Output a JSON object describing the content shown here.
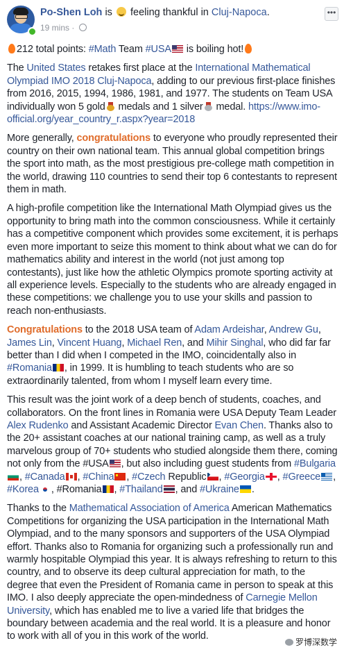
{
  "post": {
    "author": "Po-Shen Loh",
    "feeling_prefix": "is",
    "feeling_text": "feeling thankful in",
    "location": "Cluj-Napoca",
    "location_end": ".",
    "time": "19 mins",
    "time_sep": "·",
    "menu_label": "•••",
    "paragraphs": [
      [
        {
          "t": "",
          "icon": "fire"
        },
        {
          "t": "212 total points: "
        },
        {
          "t": "#Math",
          "l": 1
        },
        {
          "t": " Team "
        },
        {
          "t": "#USA",
          "l": 1
        },
        {
          "t": "",
          "icon": "flag-usa"
        },
        {
          "t": " is boiling hot!"
        },
        {
          "t": "",
          "icon": "fire"
        }
      ],
      [
        {
          "t": "The "
        },
        {
          "t": "United States",
          "l": 1
        },
        {
          "t": " retakes first place at the "
        },
        {
          "t": "International Mathematical Olympiad IMO 2018 Cluj-Napoca",
          "l": 1
        },
        {
          "t": ", adding to our previous first-place finishes from 2016, 2015, 1994, 1986, 1981, and 1977. The students on Team USA individually won 5 gold"
        },
        {
          "t": "",
          "icon": "medal-gold"
        },
        {
          "t": " medals and 1 silver"
        },
        {
          "t": "",
          "icon": "medal-silver"
        },
        {
          "t": " medal. "
        },
        {
          "t": "https://www.imo-official.org/year_country_r.aspx?year=2018",
          "l": 1
        }
      ],
      [
        {
          "t": "More generally, "
        },
        {
          "t": "congratulations",
          "h": 1
        },
        {
          "t": " to everyone who proudly represented their country on their own national team. This annual global competition brings the sport into math, as the most prestigious pre-college math competition in the world, drawing 110 countries to send their top 6 contestants to represent them in math."
        }
      ],
      [
        {
          "t": "A high-profile competition like the International Math Olympiad gives us the opportunity to bring math into the common consciousness. While it certainly has a competitive component which provides some excitement, it is perhaps even more important to seize this moment to think about what we can do for mathematics ability and interest in the world (not just among top contestants), just like how the athletic Olympics promote sporting activity at all experience levels. Especially to the students who are already engaged in these competitions: we challenge you to use your skills and passion to reach non-enthusiasts."
        }
      ],
      [
        {
          "t": "Congratulations",
          "h": 1
        },
        {
          "t": " to the 2018 USA team of "
        },
        {
          "t": "Adam Ardeishar",
          "l": 1
        },
        {
          "t": ", "
        },
        {
          "t": "Andrew Gu",
          "l": 1
        },
        {
          "t": ", "
        },
        {
          "t": "James Lin",
          "l": 1
        },
        {
          "t": ", "
        },
        {
          "t": "Vincent Huang",
          "l": 1
        },
        {
          "t": ", "
        },
        {
          "t": "Michael Ren",
          "l": 1
        },
        {
          "t": ", and "
        },
        {
          "t": "Mihir Singhal",
          "l": 1
        },
        {
          "t": ", who did far far better than I did when I competed in the IMO, coincidentally also in "
        },
        {
          "t": "#Romania",
          "l": 1
        },
        {
          "t": "",
          "icon": "flag-ro"
        },
        {
          "t": ", in 1999. It is humbling to teach students who are so extraordinarily talented, from whom I myself learn every time."
        }
      ],
      [
        {
          "t": "This result was the joint work of a deep bench of students, coaches, and collaborators. On the front lines in Romania were USA Deputy Team Leader "
        },
        {
          "t": "Alex Rudenko",
          "l": 1
        },
        {
          "t": " and Assistant Academic Director "
        },
        {
          "t": "Evan Chen",
          "l": 1
        },
        {
          "t": ". Thanks also to the 20+ assistant coaches at our national training camp, as well as a truly marvelous group of 70+ students who studied alongside them there, coming not only from the #USA"
        },
        {
          "t": "",
          "icon": "flag-usa"
        },
        {
          "t": ", but also including guest students from "
        },
        {
          "t": "#Bulgaria",
          "l": 1
        },
        {
          "t": "",
          "icon": "flag-bg"
        },
        {
          "t": ", "
        },
        {
          "t": "#Canada",
          "l": 1
        },
        {
          "t": "",
          "icon": "flag-ca"
        },
        {
          "t": ", "
        },
        {
          "t": "#China",
          "l": 1
        },
        {
          "t": "",
          "icon": "flag-cn"
        },
        {
          "t": ", "
        },
        {
          "t": "#Czech",
          "l": 1
        },
        {
          "t": " Republic"
        },
        {
          "t": "",
          "icon": "flag-cz"
        },
        {
          "t": ", "
        },
        {
          "t": "#Georgia",
          "l": 1
        },
        {
          "t": "",
          "icon": "flag-ge"
        },
        {
          "t": ", "
        },
        {
          "t": "#Greece",
          "l": 1
        },
        {
          "t": "",
          "icon": "flag-gr"
        },
        {
          "t": ", "
        },
        {
          "t": "#Korea",
          "l": 1
        },
        {
          "t": "",
          "icon": "flag-kr"
        },
        {
          "t": ", #Romania"
        },
        {
          "t": "",
          "icon": "flag-ro"
        },
        {
          "t": ", "
        },
        {
          "t": "#Thailand",
          "l": 1
        },
        {
          "t": "",
          "icon": "flag-th"
        },
        {
          "t": ", and "
        },
        {
          "t": "#Ukraine",
          "l": 1
        },
        {
          "t": "",
          "icon": "flag-ua"
        },
        {
          "t": "."
        }
      ],
      [
        {
          "t": "Thanks to the "
        },
        {
          "t": "Mathematical Association of America",
          "l": 1
        },
        {
          "t": " American Mathematics Competitions for organizing the USA participation in the International Math Olympiad, and to the many sponsors and supporters of the USA Olympiad effort. Thanks also to Romania for organizing such a professionally run and warmly hospitable Olympiad this year. It is always refreshing to return to this country, and to observe its deep cultural appreciation for math, to the degree that even the President of Romania came in person to speak at this IMO. I also deeply appreciate the open-mindedness of "
        },
        {
          "t": "Carnegie Mellon University",
          "l": 1
        },
        {
          "t": ", which has enabled me to live a varied life that bridges the boundary between academia and the real world. It is a pleasure and honor to work with all of you in this work of the world."
        }
      ]
    ]
  },
  "watermark": {
    "text": "罗博深数学"
  },
  "colors": {
    "link": "#365899",
    "highlight": "#e06c2b",
    "text": "#1d2129",
    "meta": "#90949c"
  }
}
